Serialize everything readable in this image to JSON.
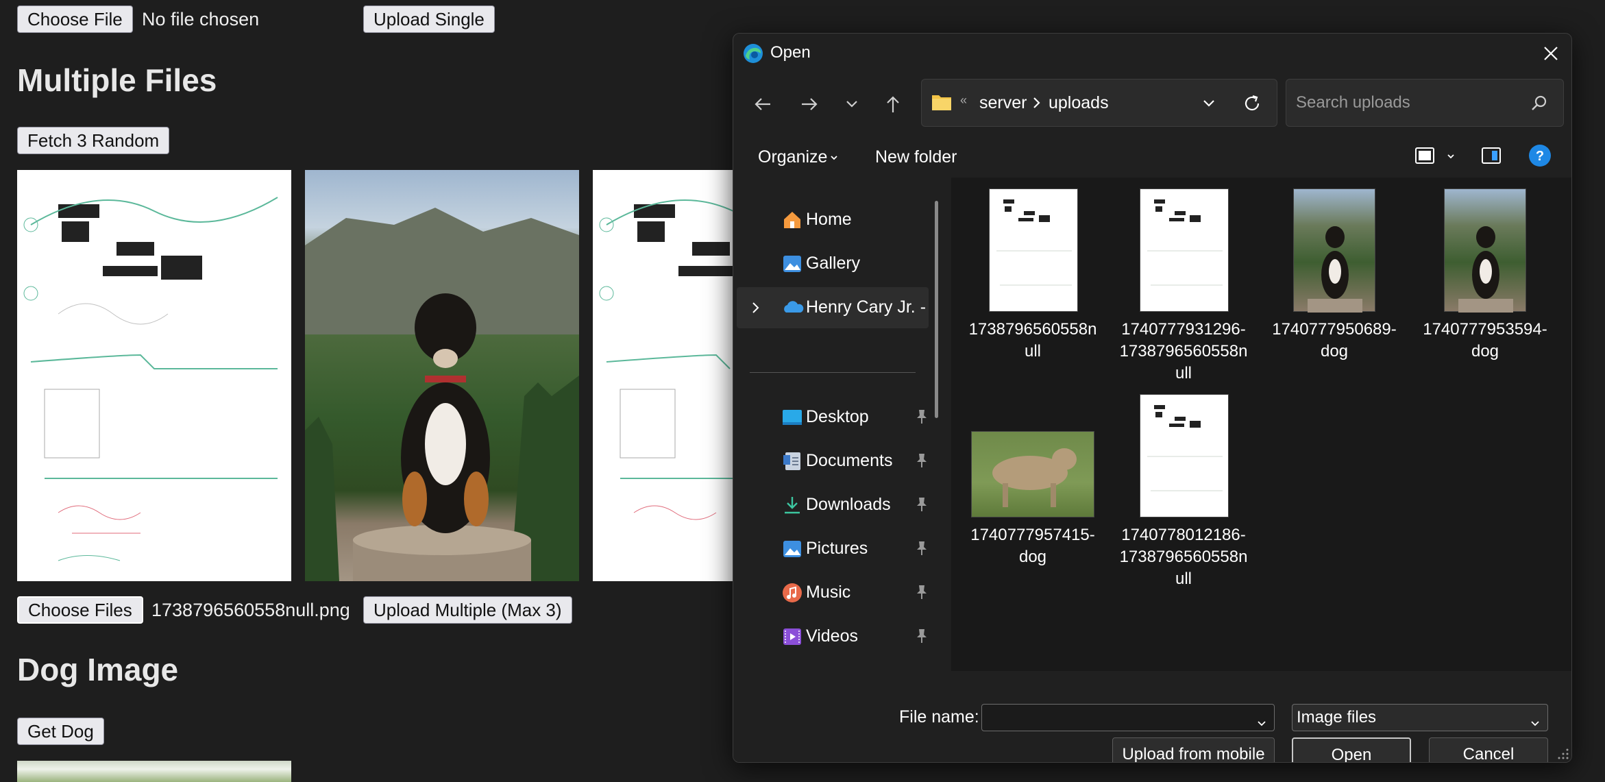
{
  "page": {
    "single": {
      "choose_label": "Choose File",
      "file_status": "No file chosen",
      "upload_label": "Upload Single"
    },
    "multiple": {
      "heading": "Multiple Files",
      "fetch_label": "Fetch 3 Random",
      "choose_label": "Choose Files",
      "file_status": "1738796560558null.png",
      "upload_label": "Upload Multiple (Max 3)"
    },
    "dog": {
      "heading": "Dog Image",
      "get_label": "Get Dog"
    }
  },
  "dialog": {
    "title": "Open",
    "breadcrumb": [
      "server",
      "uploads"
    ],
    "search_placeholder": "Search uploads",
    "toolbar": {
      "organize_label": "Organize",
      "new_folder_label": "New folder"
    },
    "nav": {
      "items": [
        {
          "label": "Home",
          "icon": "home-icon"
        },
        {
          "label": "Gallery",
          "icon": "gallery-icon"
        },
        {
          "label": "Henry Cary Jr. -",
          "icon": "onedrive-icon"
        }
      ],
      "pinned": [
        {
          "label": "Desktop",
          "icon": "desktop-icon"
        },
        {
          "label": "Documents",
          "icon": "documents-icon"
        },
        {
          "label": "Downloads",
          "icon": "downloads-icon"
        },
        {
          "label": "Pictures",
          "icon": "pictures-icon"
        },
        {
          "label": "Music",
          "icon": "music-icon"
        },
        {
          "label": "Videos",
          "icon": "videos-icon"
        }
      ]
    },
    "files": [
      {
        "name": "1738796560558null",
        "kind": "sketch"
      },
      {
        "name": "1740777931296-1738796560558null",
        "kind": "sketch"
      },
      {
        "name": "1740777950689-dog",
        "kind": "dog-mountain"
      },
      {
        "name": "1740777953594-dog",
        "kind": "dog-mountain"
      },
      {
        "name": "1740777957415-dog",
        "kind": "dog-field"
      },
      {
        "name": "1740778012186-1738796560558null",
        "kind": "sketch"
      }
    ],
    "footer": {
      "filename_label": "File name:",
      "filename_value": "",
      "filter_value": "Image files",
      "mobile_label": "Upload from mobile",
      "open_label": "Open",
      "cancel_label": "Cancel"
    }
  }
}
